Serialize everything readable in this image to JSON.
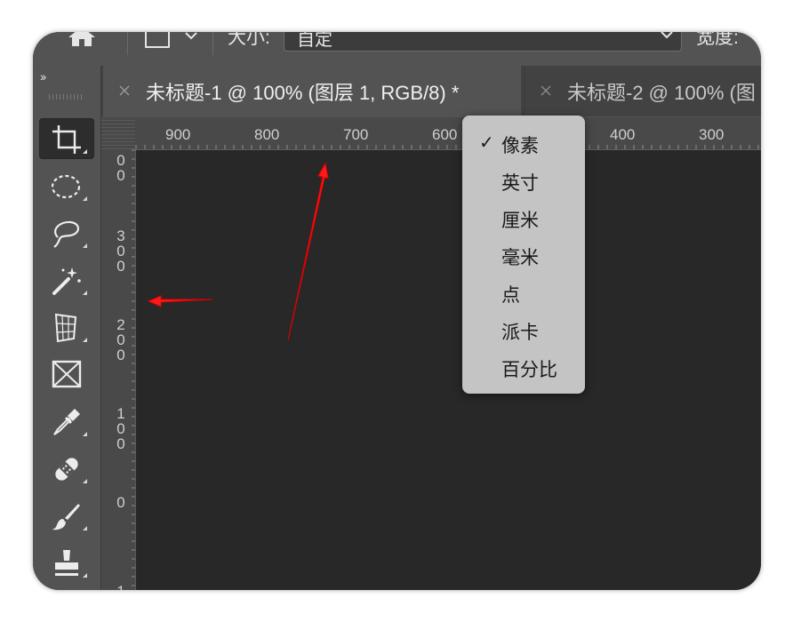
{
  "options_bar": {
    "size_label": "大小:",
    "preset_value": "自定",
    "width_label": "宽度:"
  },
  "toolbar": {
    "collapse_label": "››",
    "tools": [
      {
        "name": "crop-tool",
        "active": true
      },
      {
        "name": "ellipse-marquee-tool"
      },
      {
        "name": "lasso-tool"
      },
      {
        "name": "magic-wand-tool"
      },
      {
        "name": "perspective-crop-tool"
      },
      {
        "name": "frame-tool"
      },
      {
        "name": "eyedropper-tool"
      },
      {
        "name": "healing-brush-tool"
      },
      {
        "name": "brush-tool"
      },
      {
        "name": "clone-stamp-tool"
      }
    ]
  },
  "tabs": [
    {
      "title": "未标题-1 @ 100% (图层 1, RGB/8) *",
      "active": true
    },
    {
      "title": "未标题-2 @ 100% (图",
      "active": false
    }
  ],
  "ruler_h_labels": [
    "900",
    "800",
    "700",
    "600",
    "400",
    "300"
  ],
  "ruler_v_labels": [
    [
      "0",
      "0"
    ],
    [
      "3",
      "0",
      "0"
    ],
    [
      "2",
      "0",
      "0"
    ],
    [
      "1",
      "0",
      "0"
    ],
    [
      "0"
    ],
    [
      "1"
    ]
  ],
  "unit_menu": {
    "check_mark": "✓",
    "selected_index": 0,
    "items": [
      "像素",
      "英寸",
      "厘米",
      "毫米",
      "点",
      "派卡",
      "百分比"
    ]
  },
  "colors": {
    "panel": "#535353",
    "canvas": "#282828",
    "menu": "#c4c4c4",
    "annotation_arrow": "#ff0000"
  }
}
